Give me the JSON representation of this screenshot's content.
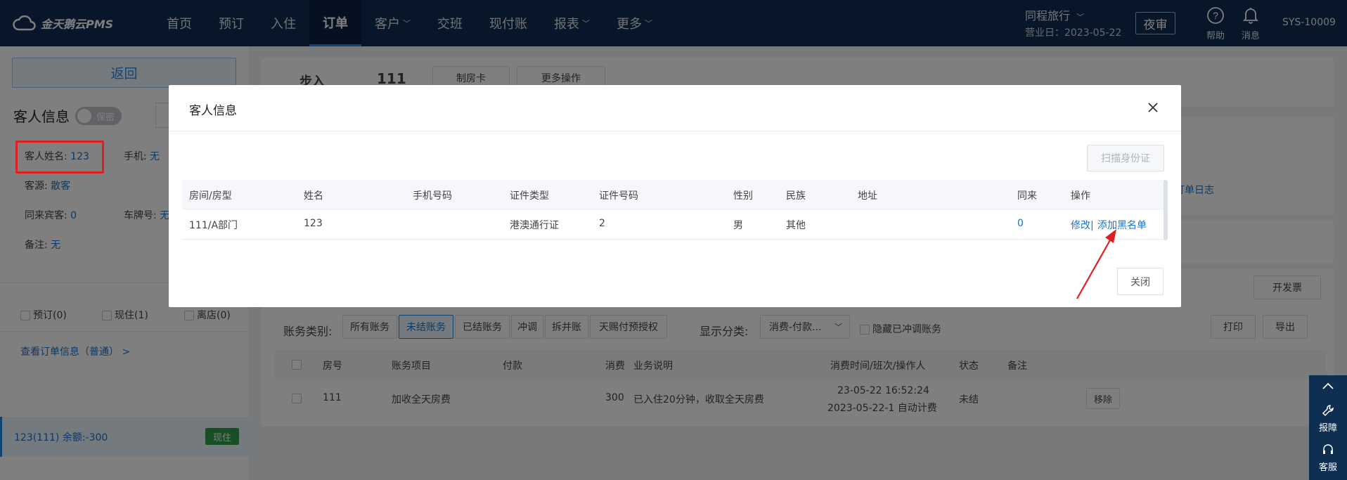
{
  "brand": {
    "name": "金天鹅云PMS"
  },
  "nav": {
    "items": [
      {
        "label": "首页",
        "dropdown": false,
        "active": false
      },
      {
        "label": "预订",
        "dropdown": false,
        "active": false
      },
      {
        "label": "入住",
        "dropdown": false,
        "active": false
      },
      {
        "label": "订单",
        "dropdown": false,
        "active": true
      },
      {
        "label": "客户",
        "dropdown": true,
        "active": false
      },
      {
        "label": "交班",
        "dropdown": false,
        "active": false
      },
      {
        "label": "现付账",
        "dropdown": false,
        "active": false
      },
      {
        "label": "报表",
        "dropdown": true,
        "active": false
      },
      {
        "label": "更多",
        "dropdown": true,
        "active": false
      }
    ],
    "hotel": "同程旅行",
    "business_date": "营业日：2023-05-22",
    "night_audit": "夜审",
    "help": "帮助",
    "messages": "消息",
    "user": "SYS-10009"
  },
  "left": {
    "back": "返回",
    "guest_info_title": "客人信息",
    "privacy_toggle": "保密",
    "guest_name_label": "客人姓名:",
    "guest_name": "123",
    "phone_label": "手机:",
    "phone": "无",
    "source_label": "客源:",
    "source": "散客",
    "companions_label": "同来宾客:",
    "companions": "0",
    "plate_label": "车牌号:",
    "plate": "无",
    "remark_label": "备注:",
    "remark": "无",
    "filters": [
      "预订(0)",
      "现住(1)",
      "离店(0)"
    ],
    "view_order": "查看订单信息（普通） >",
    "selected_room": "123(111)  余额:-300",
    "selected_status": "现住"
  },
  "main": {
    "walk_in": "步入",
    "room_no": "111",
    "make_card": "制房卡",
    "more_ops": "更多操作",
    "order_log": "订单日志",
    "invoice": "开发票",
    "account_type_label": "账务类别:",
    "account_tabs": [
      "所有账务",
      "未结账务",
      "已结账务",
      "冲调",
      "拆并账",
      "天赐付预授权"
    ],
    "display_label": "显示分类:",
    "display_value": "消费-付款...",
    "hide_reversed": "隐藏已冲调账务",
    "print": "打印",
    "export": "导出",
    "columns": [
      "房号",
      "账务项目",
      "付款",
      "消费",
      "业务说明",
      "消费时间/班次/操作人",
      "状态",
      "备注"
    ],
    "rows": [
      {
        "room": "111",
        "item": "加收全天房费",
        "payment": "",
        "consume": "300",
        "desc": "已入住20分钟，收取全天房费",
        "time1": "23-05-22 16:52:24",
        "time2": "2023-05-22-1 自动计费",
        "status": "未结",
        "action": "移除"
      }
    ]
  },
  "modal": {
    "title": "客人信息",
    "scan_id": "扫描身份证",
    "columns": [
      "房间/房型",
      "姓名",
      "手机号码",
      "证件类型",
      "证件号码",
      "性别",
      "民族",
      "地址",
      "同来",
      "操作"
    ],
    "rows": [
      {
        "room": "111/A部门",
        "name": "123",
        "phone": "",
        "id_type": "港澳通行证",
        "id_no": "2",
        "gender": "男",
        "ethnicity": "其他",
        "address": "",
        "companions": "0",
        "edit": "修改|",
        "blacklist": "添加黑名单"
      }
    ],
    "close": "关闭"
  },
  "side": {
    "report": "报障",
    "service": "客服"
  },
  "colors": {
    "nav_bg": "#0e2e52",
    "accent": "#1a73c8",
    "annotation": "#e02020",
    "status_green": "#2e9c4a"
  }
}
